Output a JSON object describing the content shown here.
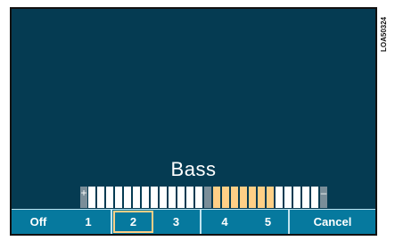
{
  "side_label": "LOA50324",
  "title": "Bass",
  "bass_bar": {
    "plus": "+",
    "minus": "–",
    "segment_count": 26,
    "highlighted_segments": [
      14,
      15,
      16,
      17,
      18,
      19,
      20
    ],
    "dark_segments": [
      13
    ],
    "colors": {
      "normal": "#ffffff",
      "highlight": "#ffcf86",
      "dark": "#7a8e99"
    }
  },
  "buttons": [
    {
      "label": "Off"
    },
    {
      "label": "1"
    },
    {
      "label": "2",
      "selected": true
    },
    {
      "label": "3"
    },
    {
      "label": "4"
    },
    {
      "label": "5"
    },
    {
      "label": "Cancel"
    }
  ],
  "colors": {
    "background": "#053b52",
    "button_bar": "#06799e",
    "selection": "#ffcf86"
  }
}
